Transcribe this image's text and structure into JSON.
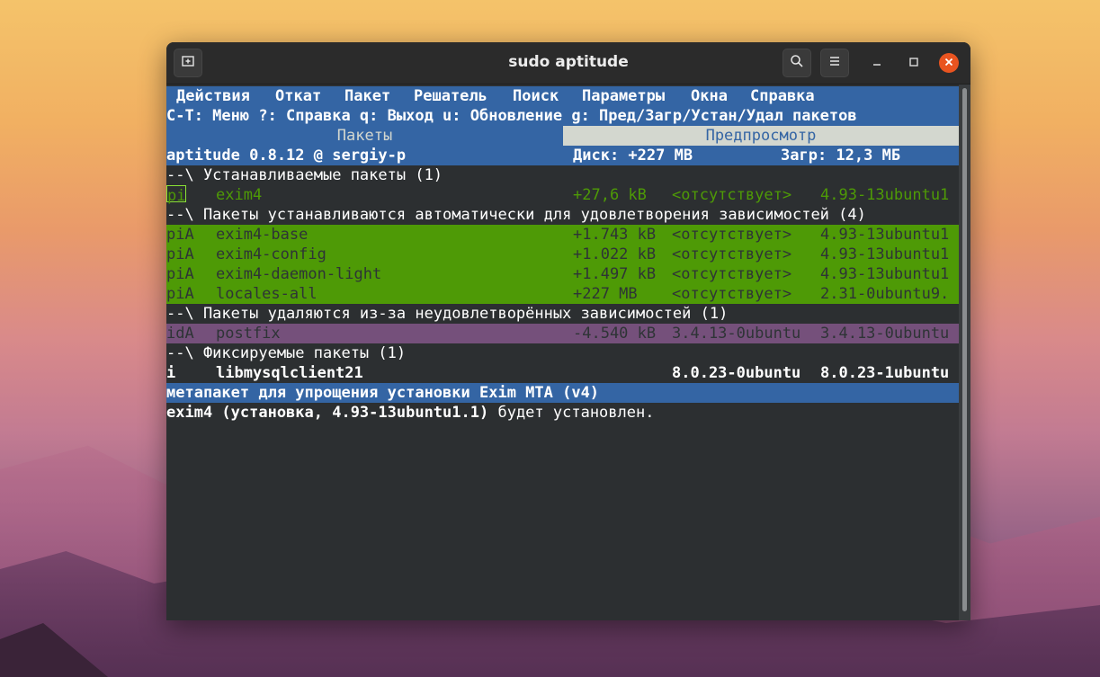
{
  "window": {
    "title": "sudo aptitude"
  },
  "menu": {
    "items": [
      "Действия",
      "Откат",
      "Пакет",
      "Решатель",
      "Поиск",
      "Параметры",
      "Окна",
      "Справка"
    ]
  },
  "hint_line": "C-T: Меню ?: Справка q: Выход u: Обновление g: Пред/Загр/Устан/Удал пакетов",
  "tabs": {
    "packages": "Пакеты",
    "preview": "Предпросмотр"
  },
  "status": {
    "version": "aptitude 0.8.12 @ sergiy-p",
    "disk": "Диск: +227 MB",
    "download": "Загр: 12,3 МБ"
  },
  "groups": {
    "installed": "--\\ Устанавливаемые пакеты (1)",
    "auto": "--\\ Пакеты устанавливаются автоматически для удовлетворения зависимостей (4)",
    "removed": "--\\ Пакеты удаляются из-за неудовлетворённых зависимостей (1)",
    "held": "--\\ Фиксируемые пакеты (1)"
  },
  "packages": {
    "exim4": {
      "flags": "pi",
      "name": "exim4",
      "size": "+27,6 kB",
      "current": "<отсутствует>",
      "candidate": "4.93-13ubuntu1"
    },
    "auto": [
      {
        "flags": "piA",
        "name": "exim4-base",
        "size": "+1.743 kB",
        "current": "<отсутствует>",
        "candidate": "4.93-13ubuntu1"
      },
      {
        "flags": "piA",
        "name": "exim4-config",
        "size": "+1.022 kB",
        "current": "<отсутствует>",
        "candidate": "4.93-13ubuntu1"
      },
      {
        "flags": "piA",
        "name": "exim4-daemon-light",
        "size": "+1.497 kB",
        "current": "<отсутствует>",
        "candidate": "4.93-13ubuntu1"
      },
      {
        "flags": "piA",
        "name": "locales-all",
        "size": "+227 MB",
        "current": "<отсутствует>",
        "candidate": "2.31-0ubuntu9."
      }
    ],
    "postfix": {
      "flags": "idA",
      "name": "postfix",
      "size": "-4.540 kB",
      "current": "3.4.13-0ubuntu",
      "candidate": "3.4.13-0ubuntu"
    },
    "libmysql": {
      "flags": "i",
      "name": "libmysqlclient21",
      "current": "8.0.23-0ubuntu",
      "candidate": "8.0.23-1ubuntu"
    }
  },
  "description": "метапакет для упрощения установки Exim MTA (v4)",
  "info_bold": "exim4 (установка, 4.93-13ubuntu1.1)",
  "info_rest": " будет установлен."
}
